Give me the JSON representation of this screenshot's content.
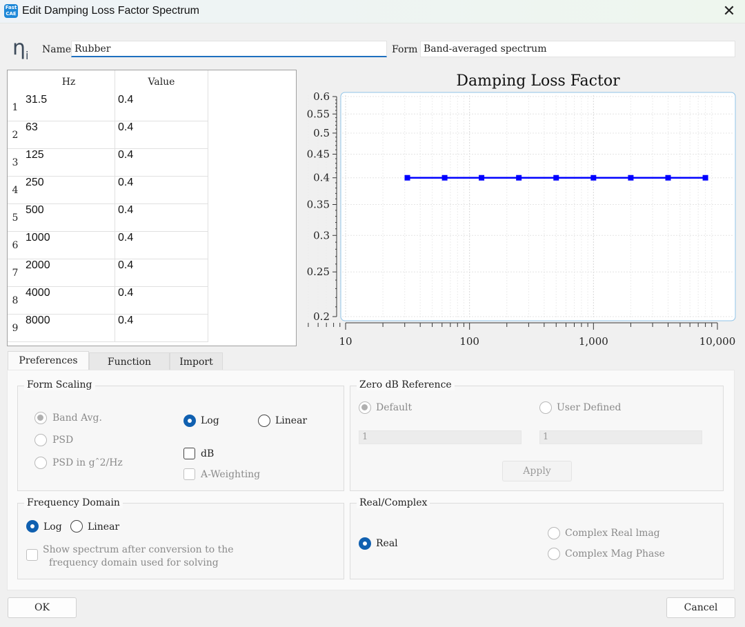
{
  "window": {
    "title": "Edit Damping Loss Factor Spectrum",
    "app_icon_text": "FastCAE"
  },
  "header": {
    "symbol": "η",
    "symbol_sub": "i",
    "name_label": "Name",
    "name_value": "Rubber",
    "form_label": "Form",
    "form_value": "Band-averaged spectrum"
  },
  "table": {
    "headers": [
      "Hz",
      "Value"
    ],
    "rows": [
      {
        "n": "1",
        "hz": "31.5",
        "value": "0.4"
      },
      {
        "n": "2",
        "hz": "63",
        "value": "0.4"
      },
      {
        "n": "3",
        "hz": "125",
        "value": "0.4"
      },
      {
        "n": "4",
        "hz": "250",
        "value": "0.4"
      },
      {
        "n": "5",
        "hz": "500",
        "value": "0.4"
      },
      {
        "n": "6",
        "hz": "1000",
        "value": "0.4"
      },
      {
        "n": "7",
        "hz": "2000",
        "value": "0.4"
      },
      {
        "n": "8",
        "hz": "4000",
        "value": "0.4"
      },
      {
        "n": "9",
        "hz": "8000",
        "value": "0.4"
      }
    ]
  },
  "chart_data": {
    "type": "line",
    "title": "Damping Loss Factor",
    "x": [
      31.5,
      63,
      125,
      250,
      500,
      1000,
      2000,
      4000,
      8000
    ],
    "series": [
      {
        "values": [
          0.4,
          0.4,
          0.4,
          0.4,
          0.4,
          0.4,
          0.4,
          0.4,
          0.4
        ],
        "color": "#0000ff"
      }
    ],
    "x_scale": "log",
    "y_scale": "log",
    "xlim": [
      10,
      10000
    ],
    "ylim": [
      0.2,
      0.6
    ],
    "x_ticks": [
      "10",
      "100",
      "1,000",
      "10,000"
    ],
    "y_ticks": [
      "0.6",
      "0.55",
      "0.5",
      "0.45",
      "0.4",
      "0.35",
      "0.3",
      "0.25",
      "0.2"
    ],
    "grid": true
  },
  "tabs": [
    "Preferences",
    "Function",
    "Import"
  ],
  "preferences": {
    "form_scaling": {
      "title": "Form  Scaling",
      "band_avg": "Band Avg.",
      "psd": "PSD",
      "psd_g2hz": "PSD in gˆ2/Hz",
      "log": "Log",
      "linear": "Linear",
      "db": "dB",
      "a_weighting": "A-Weighting"
    },
    "zero_db": {
      "title": "Zero dB Reference",
      "default": "Default",
      "user_defined": "User Defined",
      "input1": "1",
      "input2": "1",
      "apply": "Apply"
    },
    "frequency_domain": {
      "title": "Frequency Domain",
      "log": "Log",
      "linear": "Linear",
      "show_spectrum_line1": "Show spectrum after conversion to the",
      "show_spectrum_line2": "frequency domain used for solving"
    },
    "real_complex": {
      "title": "Real/Complex",
      "real": "Real",
      "complex_real_imag": "Complex Real  lmag",
      "complex_mag_phase": "Complex Mag  Phase"
    }
  },
  "footer": {
    "ok": "OK",
    "cancel": "Cancel"
  }
}
